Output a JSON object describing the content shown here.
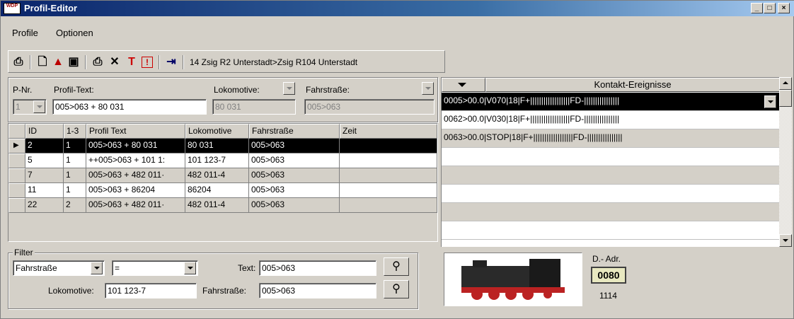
{
  "window": {
    "title": "Profil-Editor",
    "app_icon": "WDP",
    "min": "_",
    "max": "□",
    "close": "×"
  },
  "menu": {
    "profile": "Profile",
    "optionen": "Optionen"
  },
  "toolbar": {
    "icons": [
      "print-preview-icon",
      "new-document-icon",
      "document-alert-icon",
      "save-icon",
      "printer-icon",
      "delete-icon",
      "text-tool-icon",
      "warning-icon",
      "exit-icon"
    ],
    "route_text": "14 Zsig R2 Unterstadt>Zsig R104 Unterstadt"
  },
  "form": {
    "pnr_label": "P-Nr.",
    "pnr_value": "1",
    "profiltext_label": "Profil-Text:",
    "profiltext_value": "005>063 + 80 031",
    "lokomotive_label": "Lokomotive:",
    "lokomotive_value": "80 031",
    "fahrstrasse_label": "Fahrstraße:",
    "fahrstrasse_value": "005>063"
  },
  "grid": {
    "headers": [
      "ID",
      "1-3",
      "Profil Text",
      "Lokomotive",
      "Fahrstraße",
      "Zeit"
    ],
    "rows": [
      {
        "id": "2",
        "n": "1",
        "text": "005>063 + 80 031",
        "lok": "80 031",
        "fs": "005>063",
        "zeit": ""
      },
      {
        "id": "5",
        "n": "1",
        "text": "++005>063 + 101 1:",
        "lok": "101 123-7",
        "fs": "005>063",
        "zeit": ""
      },
      {
        "id": "7",
        "n": "1",
        "text": "005>063 + 482 011·",
        "lok": "482 011-4",
        "fs": "005>063",
        "zeit": ""
      },
      {
        "id": "11",
        "n": "1",
        "text": "005>063 + 86204",
        "lok": "86204",
        "fs": "005>063",
        "zeit": ""
      },
      {
        "id": "22",
        "n": "2",
        "text": "005>063 + 482 011·",
        "lok": "482 011-4",
        "fs": "005>063",
        "zeit": ""
      }
    ]
  },
  "kontakt": {
    "header": "Kontakt-Ereignisse",
    "rows": [
      "0005>00.0|V070|18|F+||||||||||||||||||FD-||||||||||||||||",
      "0062>00.0|V030|18|F+||||||||||||||||||FD-||||||||||||||||",
      "0063>00.0|STOP|18|F+||||||||||||||||||FD-||||||||||||||||"
    ]
  },
  "filter": {
    "title": "Filter",
    "field_select": "Fahrstraße",
    "operator_select": "=",
    "text_label": "Text:",
    "text_value": "005>063",
    "lokomotive_label": "Lokomotive:",
    "lokomotive_value": "101 123-7",
    "fahrstrasse_label": "Fahrstraße:",
    "fahrstrasse_value": "005>063"
  },
  "decoder": {
    "label": "D.- Adr.",
    "address": "0080",
    "number": "1114"
  },
  "colors": {
    "titlebar_start": "#0a246a",
    "titlebar_end": "#a6caf0",
    "face": "#d4d0c8",
    "selection": "#000000"
  }
}
